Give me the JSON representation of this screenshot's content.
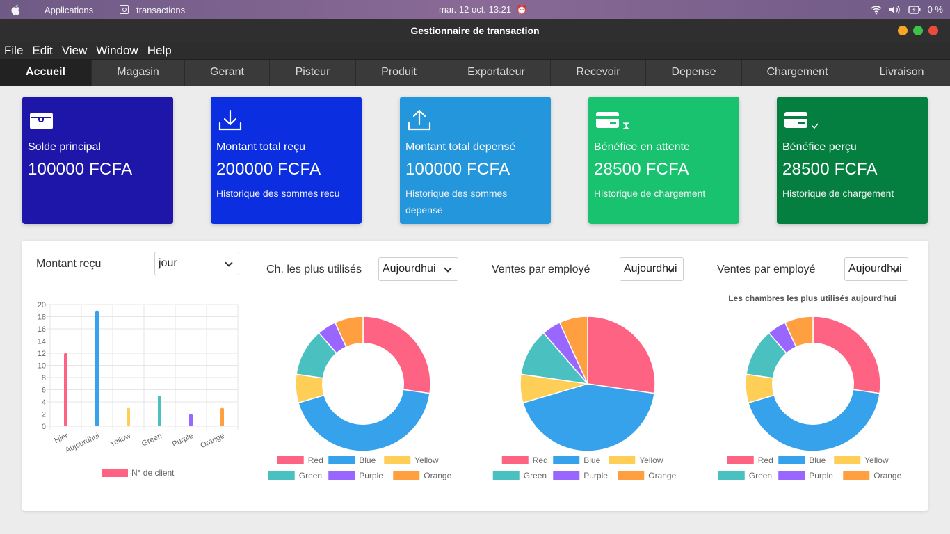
{
  "system_bar": {
    "applications": "Applications",
    "window_name": "transactions",
    "datetime": "mar. 12 oct.  13:21",
    "battery": "0 %"
  },
  "window": {
    "title": "Gestionnaire de transaction",
    "traffic_colors": [
      "#f5a623",
      "#3cc24a",
      "#e94b3c"
    ]
  },
  "menu": [
    "File",
    "Edit",
    "View",
    "Window",
    "Help"
  ],
  "tabs": [
    "Accueil",
    "Magasin",
    "Gerant",
    "Pisteur",
    "Produit",
    "Exportateur",
    "Recevoir",
    "Depense",
    "Chargement",
    "Livraison"
  ],
  "cards": [
    {
      "title": "Solde principal",
      "value": "100000 FCFA",
      "link": "",
      "color": "#1e16a8",
      "icon": "wallet-icon"
    },
    {
      "title": "Montant total reçu",
      "value": "200000 FCFA",
      "link": "Historique des sommes recu",
      "color": "#0a2ee0",
      "icon": "download-icon"
    },
    {
      "title": "Montant total depensé",
      "value": "100000 FCFA",
      "link": "Historique des sommes depensé",
      "color": "#2396dc",
      "icon": "upload-icon"
    },
    {
      "title": "Bénéfice en attente",
      "value": "28500 FCFA",
      "link": "Historique de chargement",
      "color": "#19c26e",
      "icon": "card-hourglass-icon"
    },
    {
      "title": "Bénéfice perçu",
      "value": "28500 FCFA",
      "link": "Historique de chargement",
      "color": "#057f40",
      "icon": "card-check-icon"
    }
  ],
  "panel": {
    "bar_section": {
      "title": "Montant reçu",
      "select": "jour"
    },
    "donut1_section": {
      "title": "Ch. les plus utilisés",
      "select": "Aujourdhui"
    },
    "pie_section": {
      "title": "Ventes par employé",
      "select": "Aujourdhui"
    },
    "donut2_section": {
      "title": "Ventes par employé",
      "select": "Aujourdhui",
      "chart_title": "Les chambres les plus utilisés aujourd'hui"
    }
  },
  "chart_data": [
    {
      "type": "bar",
      "categories": [
        "Hier",
        "Aujourdhui",
        "Yellow",
        "Green",
        "Purple",
        "Orange"
      ],
      "series": [
        {
          "name": "N° de client",
          "values": [
            12,
            19,
            3,
            5,
            2,
            3
          ]
        }
      ],
      "colors": [
        "#ff6384",
        "#36a2eb",
        "#ffce56",
        "#4bc0c0",
        "#9966ff",
        "#ff9f40"
      ],
      "ylim": [
        0,
        20
      ],
      "yticks": [
        0,
        2,
        4,
        6,
        8,
        10,
        12,
        14,
        16,
        18,
        20
      ],
      "grid": true,
      "legend": "bottom"
    },
    {
      "type": "pie",
      "variant": "donut",
      "categories": [
        "Red",
        "Blue",
        "Yellow",
        "Green",
        "Purple",
        "Orange"
      ],
      "values": [
        12,
        19,
        3,
        5,
        2,
        3
      ],
      "colors": [
        "#ff6384",
        "#36a2eb",
        "#ffce56",
        "#4bc0c0",
        "#9966ff",
        "#ff9f40"
      ],
      "legend": "bottom"
    },
    {
      "type": "pie",
      "categories": [
        "Red",
        "Blue",
        "Yellow",
        "Green",
        "Purple",
        "Orange"
      ],
      "values": [
        12,
        19,
        3,
        5,
        2,
        3
      ],
      "colors": [
        "#ff6384",
        "#36a2eb",
        "#ffce56",
        "#4bc0c0",
        "#9966ff",
        "#ff9f40"
      ],
      "legend": "bottom"
    },
    {
      "type": "pie",
      "variant": "donut",
      "title": "Les chambres les plus utilisés aujourd'hui",
      "categories": [
        "Red",
        "Blue",
        "Yellow",
        "Green",
        "Purple",
        "Orange"
      ],
      "values": [
        12,
        19,
        3,
        5,
        2,
        3
      ],
      "colors": [
        "#ff6384",
        "#36a2eb",
        "#ffce56",
        "#4bc0c0",
        "#9966ff",
        "#ff9f40"
      ],
      "legend": "bottom"
    }
  ]
}
